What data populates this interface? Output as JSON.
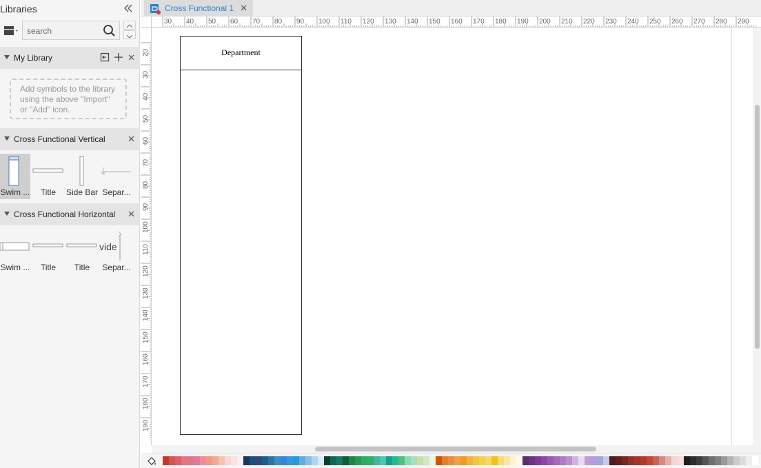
{
  "libraries": {
    "title": "Libraries",
    "search_placeholder": "search"
  },
  "my_library": {
    "label": "My Library",
    "dropzone_text": "Add symbols to the library using the above \"Import\" or \"Add\" icon."
  },
  "cf_vertical": {
    "label": "Cross Functional Vertical",
    "items": [
      {
        "label": "Swim ...",
        "icon": "vertical-swimlane-icon"
      },
      {
        "label": "Title",
        "icon": "title-bar-icon"
      },
      {
        "label": "Side Bar",
        "icon": "side-bar-icon"
      },
      {
        "label": "Separ...",
        "icon": "separator-icon"
      }
    ]
  },
  "cf_horizontal": {
    "label": "Cross Functional Horizontal",
    "items": [
      {
        "label": "Swim ...",
        "icon": "horizontal-swimlane-icon"
      },
      {
        "label": "Title",
        "icon": "title-bar-icon"
      },
      {
        "label": "Title",
        "icon": "title-bar-icon"
      },
      {
        "label": "Separ...",
        "icon": "separator-icon"
      }
    ],
    "separator_glyph": "vide"
  },
  "tab": {
    "label": "Cross Functional 1"
  },
  "ruler": {
    "top_labels": [
      "30",
      "40",
      "50",
      "60",
      "70",
      "80",
      "90",
      "100",
      "110",
      "120",
      "130",
      "140",
      "150",
      "160",
      "170",
      "180",
      "190",
      "200",
      "210",
      "220",
      "230",
      "240",
      "250",
      "260",
      "270",
      "280",
      "290"
    ],
    "left_labels": [
      "20",
      "30",
      "40",
      "50",
      "60",
      "70",
      "80",
      "90",
      "100",
      "110",
      "120",
      "130",
      "140",
      "150",
      "160",
      "170",
      "180",
      "190"
    ]
  },
  "canvas": {
    "shape_header": "Department"
  },
  "palette": {
    "colors": [
      "#c0392b",
      "#d9534f",
      "#e05c6a",
      "#e8737f",
      "#e57386",
      "#e07a9a",
      "#ef8a9e",
      "#f09a7d",
      "#f2a98e",
      "#f6c2b3",
      "#f8d6d6",
      "#fbe3e3",
      "#fdeeee",
      "#17375e",
      "#1f4e79",
      "#2e4a7d",
      "#1a5f8c",
      "#2874a6",
      "#3c8dbc",
      "#2e86de",
      "#3498db",
      "#1f9bde",
      "#5dade2",
      "#85c1e9",
      "#aed6f1",
      "#d6eaf8",
      "#0b3d2e",
      "#0e6655",
      "#117a65",
      "#145a32",
      "#1e8449",
      "#239b56",
      "#27ae60",
      "#28b463",
      "#45b39d",
      "#48c9b0",
      "#16a085",
      "#1abc9c",
      "#52be80",
      "#82e0aa",
      "#a9dfbf",
      "#c5e1a5",
      "#d4e6c3",
      "#e8f5e9",
      "#d35400",
      "#e67e22",
      "#eb8c3a",
      "#f0a04b",
      "#f39c12",
      "#f5b041",
      "#f4c542",
      "#f7d04a",
      "#f9d56e",
      "#f1c40f",
      "#f7dc6f",
      "#f9e79f",
      "#fcf3cf",
      "#fef9e7",
      "#5b2c6f",
      "#6c3483",
      "#7d3c98",
      "#8e44ad",
      "#9b59b6",
      "#a569bd",
      "#af7ac5",
      "#bb8fce",
      "#d2b4de",
      "#e8daef",
      "#c39bd3",
      "#b39ddb",
      "#9fa8da",
      "#c5cae9",
      "#4a1c1c",
      "#641e16",
      "#78281f",
      "#943126",
      "#a93226",
      "#b03a2e",
      "#cb4335",
      "#cd6155",
      "#d98880",
      "#e6b0aa",
      "#f2d7d5",
      "#fadbd8",
      "#1c1c1c",
      "#2c2c2c",
      "#3d3d3d",
      "#555555",
      "#6e6e6e",
      "#808080",
      "#999999",
      "#b3b3b3",
      "#cccccc",
      "#dddddd",
      "#eeeeee",
      "#ffffff"
    ]
  }
}
